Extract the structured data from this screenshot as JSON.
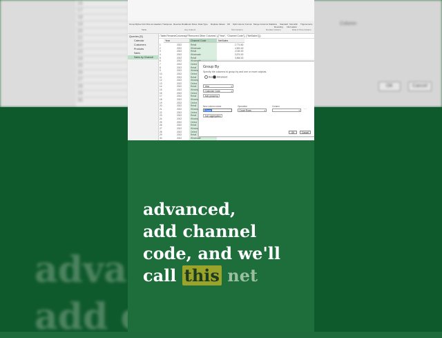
{
  "background": {
    "column_label": "Column",
    "ok_label": "OK",
    "cancel_label": "Cancel",
    "row_numbers": [
      "16",
      "17",
      "18",
      "19",
      "20",
      "21",
      "22",
      "23",
      "24",
      "25",
      "26",
      "27",
      "28",
      "29",
      "30"
    ],
    "caption_lines": [
      "adva",
      "add c"
    ]
  },
  "ribbon": {
    "buttons": [
      "Group By",
      "Use First Row as Headers",
      "Transpose",
      "Reverse Rows",
      "Count Rows",
      "Data Type",
      "Replace Values",
      "Fill",
      "Split Column",
      "Format",
      "Merge Columns",
      "Statistics",
      "Standard",
      "Scientific",
      "Trigonometry",
      "Rounding",
      "Information"
    ],
    "groups": [
      "Table",
      "Any Column",
      "Text Column",
      "Number Column",
      "Date & Time Column"
    ]
  },
  "formula_bar": {
    "text": "= Table.RenameColumns(#\"Removed Other Columns\",{{\"Year\", \"Channel Code\"}, {\"NetSales\"}})"
  },
  "queries_pane": {
    "header": "Queries [5]",
    "items": [
      "Calendar",
      "Customers",
      "Products",
      "Sales",
      "Sales by Channel"
    ],
    "selected_index": 4
  },
  "grid": {
    "headers": [
      "Year",
      "Channel Code",
      "NetSales"
    ],
    "rows": [
      {
        "n": "1",
        "year": "2022",
        "code": "Retail",
        "sales": "2,774.80"
      },
      {
        "n": "2",
        "year": "2022",
        "code": "Wholesale",
        "sales": "4,900.00"
      },
      {
        "n": "3",
        "year": "2022",
        "code": "Retail",
        "sales": "2,030.00"
      },
      {
        "n": "4",
        "year": "2022",
        "code": "Wholesale",
        "sales": "3,570.00"
      },
      {
        "n": "5",
        "year": "2022",
        "code": "Retail",
        "sales": "3,966.00"
      },
      {
        "n": "6",
        "year": "2022",
        "code": "Wholesale",
        "sales": ""
      },
      {
        "n": "7",
        "year": "2022",
        "code": "Online",
        "sales": ""
      },
      {
        "n": "8",
        "year": "2022",
        "code": "Retail",
        "sales": ""
      },
      {
        "n": "9",
        "year": "2022",
        "code": "Wholesale",
        "sales": ""
      },
      {
        "n": "10",
        "year": "2022",
        "code": "Online",
        "sales": ""
      },
      {
        "n": "11",
        "year": "2022",
        "code": "Retail",
        "sales": ""
      },
      {
        "n": "12",
        "year": "2022",
        "code": "Wholesale",
        "sales": ""
      },
      {
        "n": "13",
        "year": "2022",
        "code": "Online",
        "sales": ""
      },
      {
        "n": "14",
        "year": "2022",
        "code": "Retail",
        "sales": ""
      },
      {
        "n": "15",
        "year": "2022",
        "code": "Wholesale",
        "sales": ""
      },
      {
        "n": "16",
        "year": "2022",
        "code": "Online",
        "sales": ""
      },
      {
        "n": "17",
        "year": "2022",
        "code": "Retail",
        "sales": ""
      },
      {
        "n": "18",
        "year": "2022",
        "code": "Wholesale",
        "sales": ""
      },
      {
        "n": "19",
        "year": "2022",
        "code": "Online",
        "sales": ""
      },
      {
        "n": "20",
        "year": "2022",
        "code": "Retail",
        "sales": ""
      },
      {
        "n": "21",
        "year": "2022",
        "code": "Wholesale",
        "sales": ""
      },
      {
        "n": "22",
        "year": "2022",
        "code": "Online",
        "sales": ""
      },
      {
        "n": "23",
        "year": "2022",
        "code": "Retail",
        "sales": ""
      },
      {
        "n": "24",
        "year": "2022",
        "code": "Wholesale",
        "sales": ""
      },
      {
        "n": "25",
        "year": "2022",
        "code": "Online",
        "sales": ""
      },
      {
        "n": "26",
        "year": "2022",
        "code": "Retail",
        "sales": ""
      },
      {
        "n": "27",
        "year": "2022",
        "code": "Wholesale",
        "sales": ""
      },
      {
        "n": "28",
        "year": "2022",
        "code": "Online",
        "sales": ""
      },
      {
        "n": "29",
        "year": "2022",
        "code": "Retail",
        "sales": "2,774.80"
      },
      {
        "n": "30",
        "year": "2022",
        "code": "Wholesale",
        "sales": ""
      }
    ]
  },
  "dialog": {
    "title": "Group By",
    "subtitle": "Specify the columns to group by and one or more outputs.",
    "radio_basic": "Basic",
    "radio_advanced": "Advanced",
    "group_field_1": "Year",
    "group_field_2": "Customer Code",
    "add_grouping": "Add grouping",
    "new_column_label": "New column name",
    "operation_label": "Operation",
    "column_label": "Column",
    "new_column_value": "Count",
    "operation_value": "Count Rows",
    "column_value": "",
    "add_aggregation": "Add aggregation",
    "ok": "OK",
    "cancel": "Cancel"
  },
  "caption": {
    "line1": "advanced,",
    "line2": "add channel",
    "line3": "code, and we'll",
    "line4_pre": "call ",
    "line4_highlight": "this",
    "line4_post": " net"
  },
  "colors": {
    "panel_green": "#1d6e3b",
    "highlight": "#9aa32a",
    "selected_column": "#b6dbc2"
  }
}
